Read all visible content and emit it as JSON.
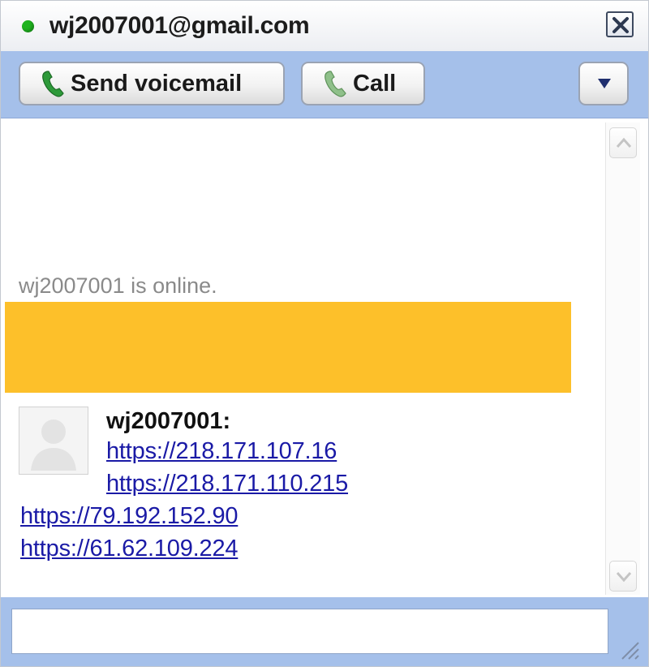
{
  "window": {
    "title": "wj2007001@gmail.com",
    "status": "online",
    "status_color": "#1fb31f"
  },
  "toolbar": {
    "voicemail_label": "Send voicemail",
    "call_label": "Call",
    "menu_icon": "triangle-down-icon"
  },
  "messages": {
    "status_line": "wj2007001 is online.",
    "highlight_color": "#fdc02a",
    "sender": "wj2007001:",
    "links": [
      "https://218.171.107.16",
      "https://218.171.110.215",
      "https://79.192.152.90",
      "https://61.62.109.224"
    ]
  },
  "input": {
    "value": "",
    "placeholder": ""
  },
  "colors": {
    "toolbar_bg": "#a5c0ea",
    "link": "#1a1aa6"
  }
}
